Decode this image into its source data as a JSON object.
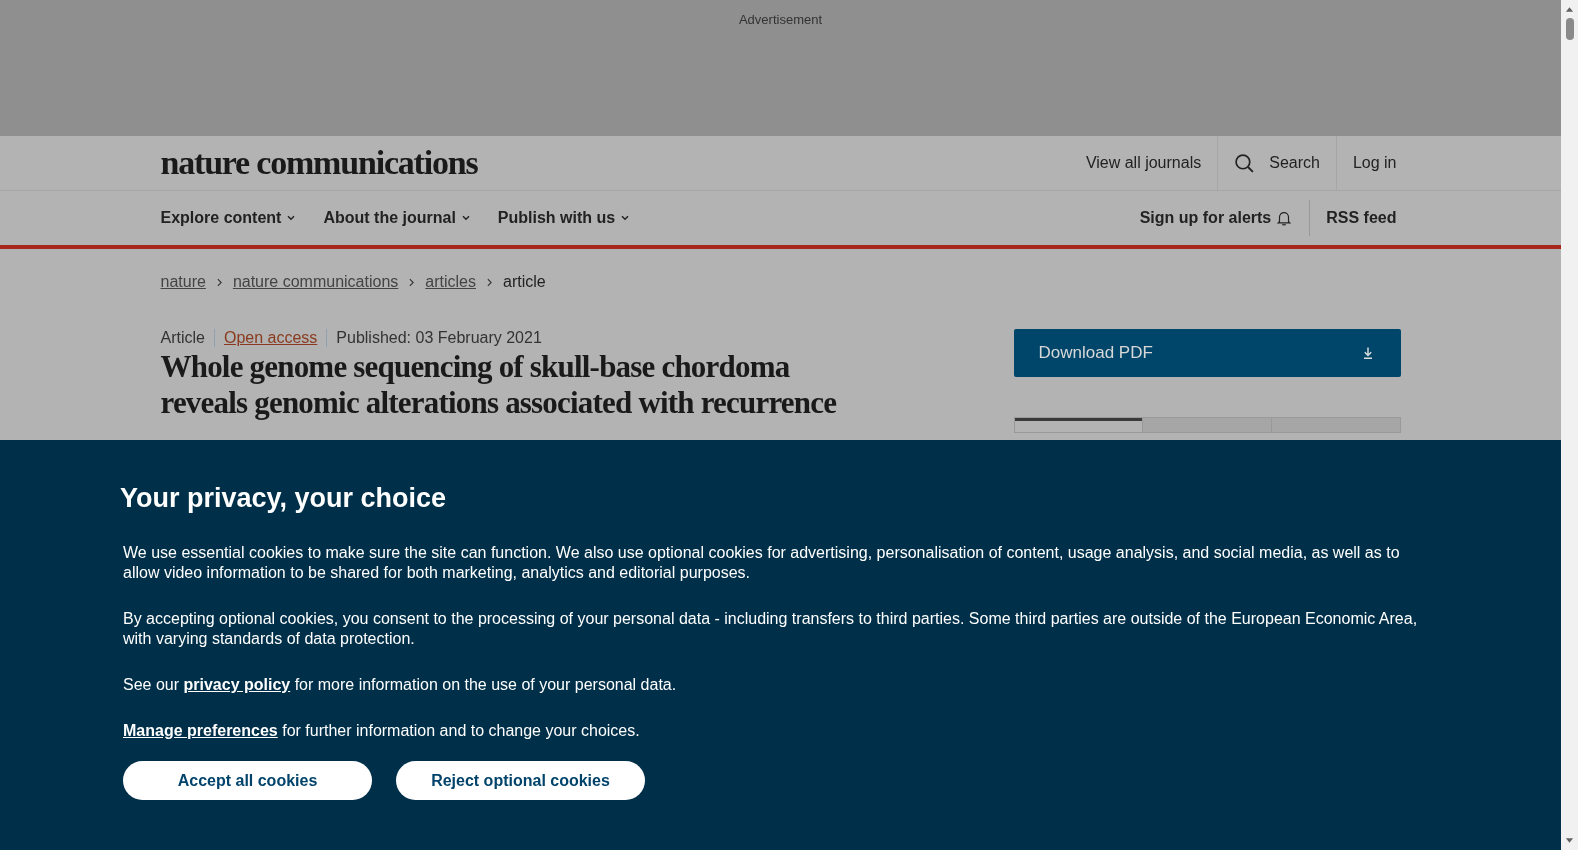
{
  "advertisement": {
    "label": "Advertisement"
  },
  "header": {
    "logo": "nature communications",
    "links": [
      {
        "label": "View all journals",
        "kind": "text"
      },
      {
        "label": "Search",
        "kind": "search"
      },
      {
        "label": "Log in",
        "kind": "text"
      }
    ]
  },
  "nav": {
    "menus": [
      "Explore content",
      "About the journal",
      "Publish with us"
    ],
    "actions": [
      {
        "label": "Sign up for alerts",
        "kind": "alerts"
      },
      {
        "label": "RSS feed",
        "kind": "text"
      }
    ]
  },
  "breadcrumbs": [
    {
      "label": "nature",
      "link": true
    },
    {
      "label": "nature communications",
      "link": true
    },
    {
      "label": "articles",
      "link": true
    },
    {
      "label": "article",
      "link": false
    }
  ],
  "article": {
    "type": "Article",
    "access": "Open access",
    "published": "Published: 03 February 2021",
    "title_lines": [
      "Whole genome sequencing of skull-base chordoma",
      "reveals genomic alterations associated with recurrence"
    ]
  },
  "sidebar": {
    "download": "Download PDF",
    "tabs": [
      {
        "selected": true
      },
      {
        "selected": false
      },
      {
        "selected": false
      }
    ]
  },
  "cookie_banner": {
    "heading": "Your privacy, your choice",
    "paragraphs": [
      [
        {
          "kind": "text",
          "text": "We use essential cookies to make sure the site can function. We also use optional cookies for advertising, personalisation of content, usage analysis, and social media, as well as to allow video information to be shared for both marketing, analytics and editorial purposes."
        }
      ],
      [
        {
          "kind": "text",
          "text": "By accepting optional cookies, you consent to the processing of your personal data - including transfers to third parties. Some third parties are outside of the European Economic Area, with varying standards of data protection."
        }
      ],
      [
        {
          "kind": "text",
          "text": "See our "
        },
        {
          "kind": "link",
          "text": "privacy policy"
        },
        {
          "kind": "text",
          "text": " for more information on the use of your personal data."
        }
      ],
      [
        {
          "kind": "link",
          "text": "Manage preferences"
        },
        {
          "kind": "text",
          "text": " for further information and to change your choices."
        }
      ]
    ],
    "buttons": [
      "Accept all cookies",
      "Reject optional cookies"
    ]
  }
}
